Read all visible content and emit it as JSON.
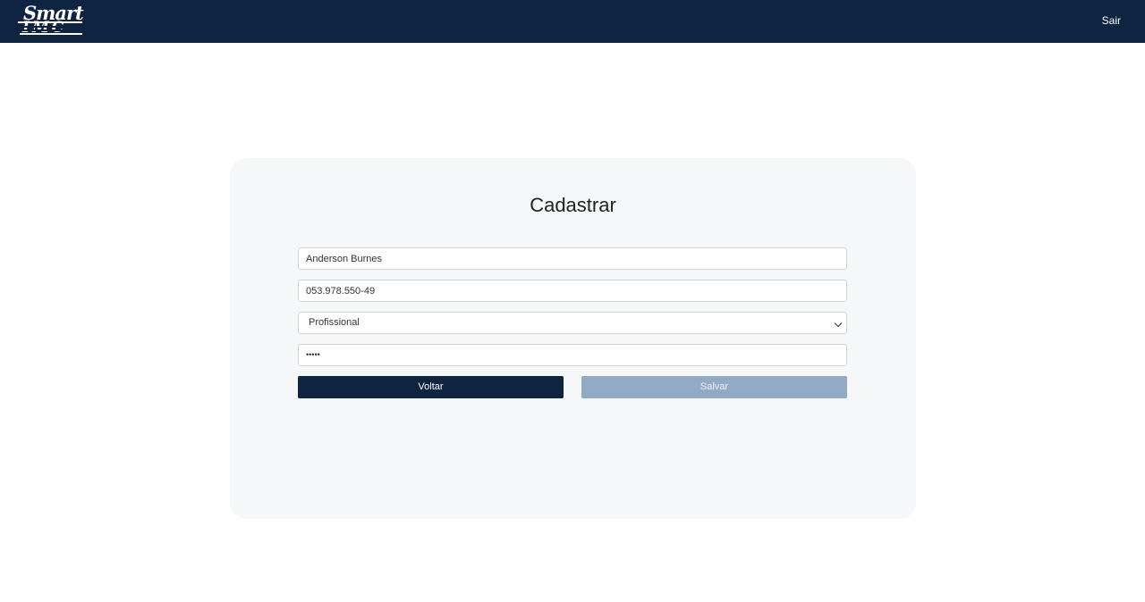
{
  "navbar": {
    "logo_line1": "Smart",
    "logo_line2": "IMC",
    "logout_label": "Sair"
  },
  "form": {
    "title": "Cadastrar",
    "name_value": "Anderson Burnes",
    "cpf_value": "053.978.550-49",
    "role_selected": "Profissional",
    "password_masked": "•••••",
    "back_label": "Voltar",
    "save_label": "Salvar"
  },
  "colors": {
    "navbar_bg": "#0e2441",
    "primary_button": "#0e2441",
    "disabled_button": "#93aac6",
    "card_bg": "#f6f7f9"
  }
}
